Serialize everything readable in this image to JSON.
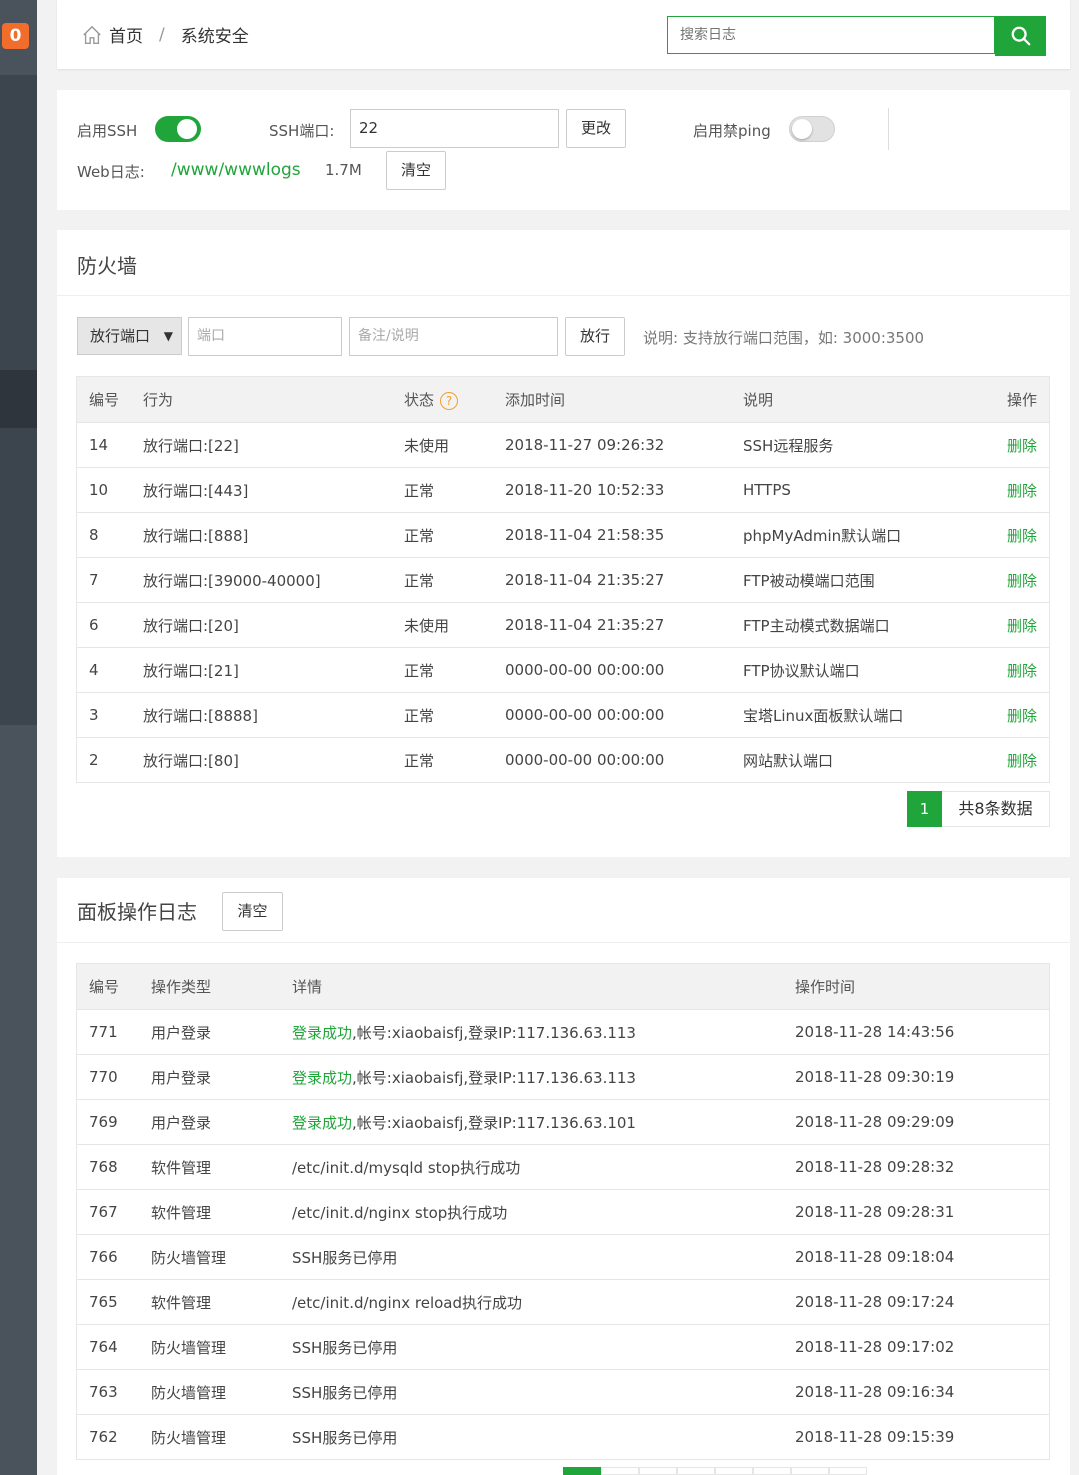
{
  "badge": "0",
  "breadcrumb": {
    "home": "首页",
    "separator": "/",
    "current": "系统安全"
  },
  "search": {
    "placeholder": "搜索日志"
  },
  "settings": {
    "ssh_label": "启用SSH",
    "ssh_enabled": true,
    "ssh_port_label": "SSH端口:",
    "ssh_port_value": "22",
    "change_button": "更改",
    "ping_label": "启用禁ping",
    "ping_enabled": false,
    "weblog_label": "Web日志:",
    "weblog_path": "/www/wwwlogs",
    "weblog_size": "1.7M",
    "clear_button": "清空"
  },
  "firewall": {
    "title": "防火墙",
    "select_value": "放行端口",
    "port_placeholder": "端口",
    "remark_placeholder": "备注/说明",
    "allow_button": "放行",
    "hint": "说明: 支持放行端口范围，如: 3000:3500",
    "columns": [
      "编号",
      "行为",
      "状态",
      "添加时间",
      "说明",
      "操作"
    ],
    "help_icon_text": "?",
    "rows": [
      {
        "id": "14",
        "action": "放行端口:[22]",
        "status": "未使用",
        "time": "2018-11-27 09:26:32",
        "desc": "SSH远程服务",
        "op": "删除"
      },
      {
        "id": "10",
        "action": "放行端口:[443]",
        "status": "正常",
        "time": "2018-11-20 10:52:33",
        "desc": "HTTPS",
        "op": "删除"
      },
      {
        "id": "8",
        "action": "放行端口:[888]",
        "status": "正常",
        "time": "2018-11-04 21:58:35",
        "desc": "phpMyAdmin默认端口",
        "op": "删除"
      },
      {
        "id": "7",
        "action": "放行端口:[39000-40000]",
        "status": "正常",
        "time": "2018-11-04 21:35:27",
        "desc": "FTP被动模端口范围",
        "op": "删除"
      },
      {
        "id": "6",
        "action": "放行端口:[20]",
        "status": "未使用",
        "time": "2018-11-04 21:35:27",
        "desc": "FTP主动模式数据端口",
        "op": "删除"
      },
      {
        "id": "4",
        "action": "放行端口:[21]",
        "status": "正常",
        "time": "0000-00-00 00:00:00",
        "desc": "FTP协议默认端口",
        "op": "删除"
      },
      {
        "id": "3",
        "action": "放行端口:[8888]",
        "status": "正常",
        "time": "0000-00-00 00:00:00",
        "desc": "宝塔Linux面板默认端口",
        "op": "删除"
      },
      {
        "id": "2",
        "action": "放行端口:[80]",
        "status": "正常",
        "time": "0000-00-00 00:00:00",
        "desc": "网站默认端口",
        "op": "删除"
      }
    ],
    "pager": {
      "current": "1",
      "total": "共8条数据"
    }
  },
  "logs": {
    "title": "面板操作日志",
    "clear_button": "清空",
    "columns": [
      "编号",
      "操作类型",
      "详情",
      "操作时间"
    ],
    "rows": [
      {
        "id": "771",
        "type": "用户登录",
        "detail_hl": "登录成功",
        "detail": ",帐号:xiaobaisfj,登录IP:117.136.63.113",
        "time": "2018-11-28 14:43:56"
      },
      {
        "id": "770",
        "type": "用户登录",
        "detail_hl": "登录成功",
        "detail": ",帐号:xiaobaisfj,登录IP:117.136.63.113",
        "time": "2018-11-28 09:30:19"
      },
      {
        "id": "769",
        "type": "用户登录",
        "detail_hl": "登录成功",
        "detail": ",帐号:xiaobaisfj,登录IP:117.136.63.101",
        "time": "2018-11-28 09:29:09"
      },
      {
        "id": "768",
        "type": "软件管理",
        "detail_hl": "",
        "detail": "/etc/init.d/mysqld stop执行成功",
        "time": "2018-11-28 09:28:32"
      },
      {
        "id": "767",
        "type": "软件管理",
        "detail_hl": "",
        "detail": "/etc/init.d/nginx stop执行成功",
        "time": "2018-11-28 09:28:31"
      },
      {
        "id": "766",
        "type": "防火墙管理",
        "detail_hl": "",
        "detail": "SSH服务已停用",
        "time": "2018-11-28 09:18:04"
      },
      {
        "id": "765",
        "type": "软件管理",
        "detail_hl": "",
        "detail": "/etc/init.d/nginx reload执行成功",
        "time": "2018-11-28 09:17:24"
      },
      {
        "id": "764",
        "type": "防火墙管理",
        "detail_hl": "",
        "detail": "SSH服务已停用",
        "time": "2018-11-28 09:17:02"
      },
      {
        "id": "763",
        "type": "防火墙管理",
        "detail_hl": "",
        "detail": "SSH服务已停用",
        "time": "2018-11-28 09:16:34"
      },
      {
        "id": "762",
        "type": "防火墙管理",
        "detail_hl": "",
        "detail": "SSH服务已停用",
        "time": "2018-11-28 09:15:39"
      }
    ]
  },
  "colors": {
    "accent": "#20a53a",
    "badge": "#f06d2b",
    "sidebar": "#3c444d"
  },
  "icons": [
    "home-icon",
    "search-icon",
    "help-icon",
    "caret-down-icon"
  ]
}
